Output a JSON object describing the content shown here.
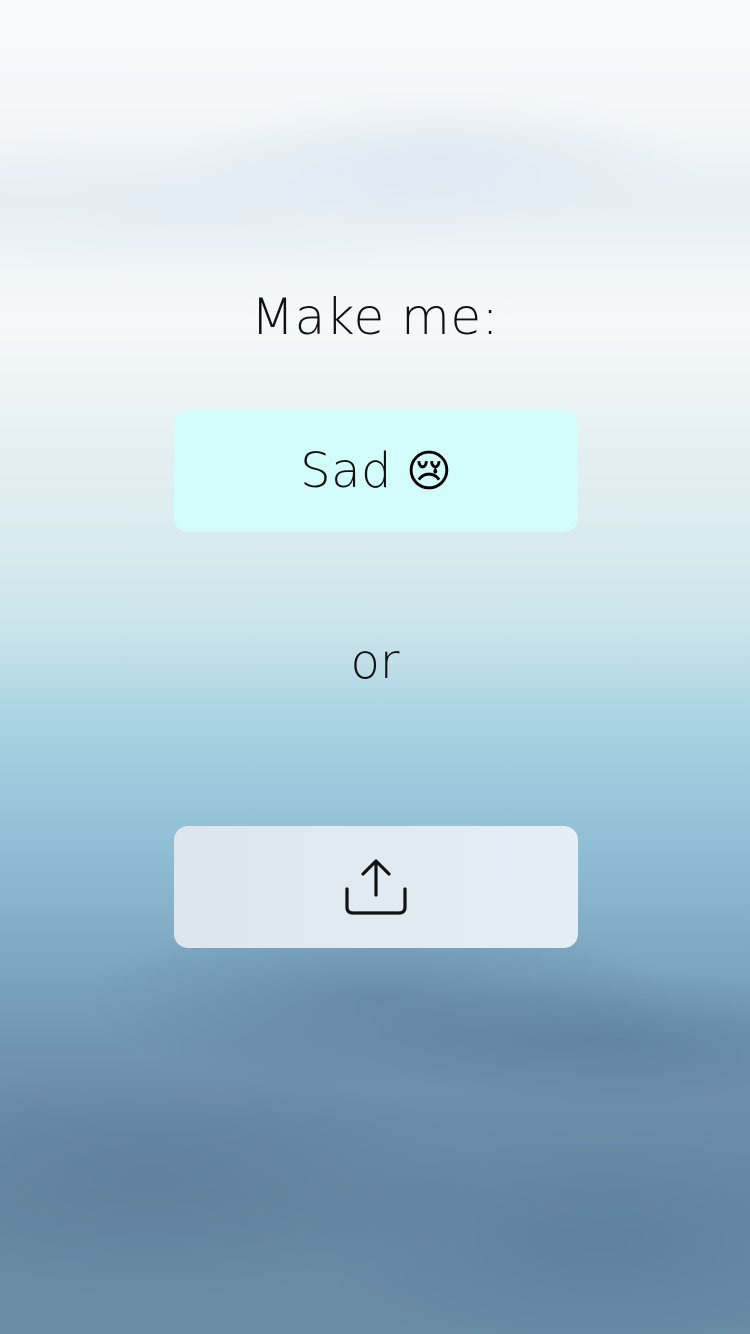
{
  "screen": {
    "prompt_label": "Make me:",
    "mood_button": {
      "label": "Sad",
      "emoji": "😢",
      "background_color": "#d2fdfb"
    },
    "separator_text": "or",
    "upload_button": {
      "icon": "upload-icon"
    }
  }
}
